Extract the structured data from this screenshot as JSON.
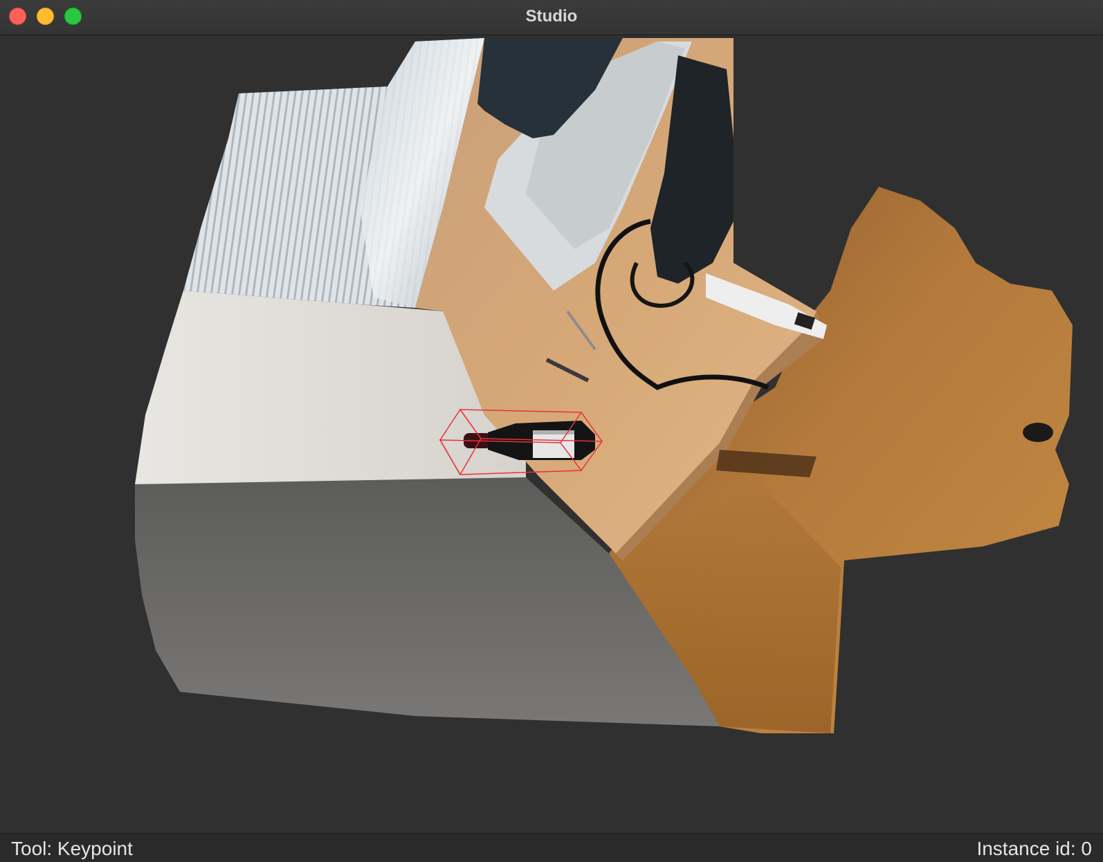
{
  "window": {
    "title": "Studio"
  },
  "viewport": {
    "scene": "3d-point-cloud-scene",
    "selected_object": "wine-bottle"
  },
  "status": {
    "tool": "Tool: Keypoint",
    "instance": "Instance id: 0"
  },
  "colors": {
    "background": "#303030",
    "bounding_box": "#e8323a",
    "close": "#fe5f57",
    "minimize": "#febc2e",
    "maximize": "#28c840"
  }
}
